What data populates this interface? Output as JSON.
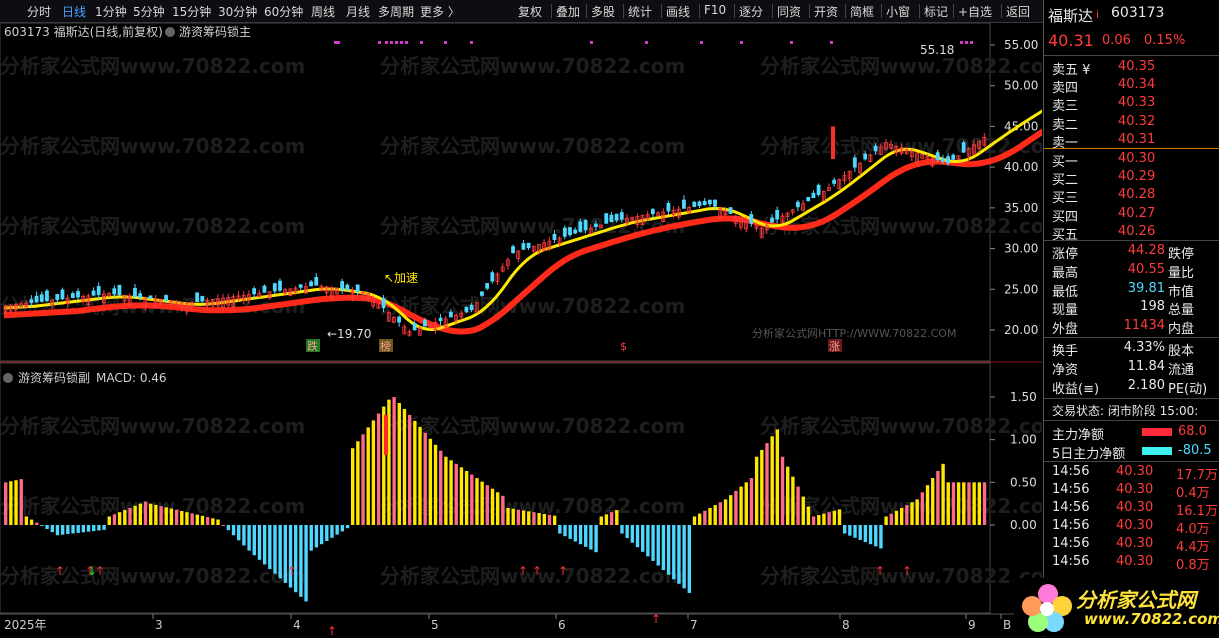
{
  "toolbar": {
    "left": [
      "分时",
      "日线",
      "1分钟",
      "5分钟",
      "15分钟",
      "30分钟",
      "60分钟",
      "周线",
      "月线",
      "多周期",
      "更多 〉"
    ],
    "active": "日线",
    "right": [
      "复权",
      "叠加",
      "多股",
      "统计",
      "画线",
      "F10",
      "逐分",
      "同资",
      "开资",
      "简框",
      "小窗",
      "标记",
      "+自选",
      "返回"
    ]
  },
  "main_chart": {
    "title": "603173 福斯达(日线,前复权)",
    "indicator_name": "游资筹码锁主",
    "y_ticks": [
      "55.00",
      "50.00",
      "45.00",
      "40.00",
      "35.00",
      "30.00",
      "25.00",
      "20.00"
    ],
    "high_label": "55.18",
    "low_label": "19.70",
    "accel_label": "加速",
    "watermark": "分析家公式网www.70822.com",
    "watermark_small": "分析家公式网HTTP://WWW.70822.COM",
    "markers": [
      "跌",
      "榜",
      "$",
      "涨"
    ]
  },
  "sub_chart": {
    "indicator_name": "游资筹码锁副",
    "macd_label": "MACD: 0.46",
    "y_ticks": [
      "1.50",
      "1.00",
      "0.50",
      "0.00"
    ]
  },
  "x_axis": [
    "2025年",
    "3",
    "4",
    "5",
    "6",
    "7",
    "8",
    "9",
    "B"
  ],
  "quote": {
    "name": "福斯达",
    "code": "603173",
    "price": "40.31",
    "change": "0.06",
    "change_pct": "0.15%",
    "sells": [
      {
        "label": "卖五 ¥",
        "price": "40.35"
      },
      {
        "label": "卖四",
        "price": "40.34"
      },
      {
        "label": "卖三",
        "price": "40.33"
      },
      {
        "label": "卖二",
        "price": "40.32"
      },
      {
        "label": "卖一",
        "price": "40.31"
      }
    ],
    "buys": [
      {
        "label": "买一",
        "price": "40.30"
      },
      {
        "label": "买二",
        "price": "40.29"
      },
      {
        "label": "买三",
        "price": "40.28"
      },
      {
        "label": "买四",
        "price": "40.27"
      },
      {
        "label": "买五",
        "price": "40.26"
      }
    ],
    "stats": [
      {
        "label": "涨停",
        "value": "44.28",
        "label2": "跌停",
        "color": "red"
      },
      {
        "label": "最高",
        "value": "40.55",
        "label2": "量比",
        "color": "red"
      },
      {
        "label": "最低",
        "value": "39.81",
        "label2": "市值",
        "color": "cyan"
      },
      {
        "label": "现量",
        "value": "198",
        "label2": "总量",
        "color": "white"
      },
      {
        "label": "外盘",
        "value": "11434",
        "label2": "内盘",
        "color": "red"
      }
    ],
    "stats2": [
      {
        "label": "换手",
        "value": "4.33%",
        "label2": "股本"
      },
      {
        "label": "净资",
        "value": "11.84",
        "label2": "流通"
      },
      {
        "label": "收益(≡)",
        "value": "2.180",
        "label2": "PE(动)"
      }
    ],
    "trade_status": "交易状态: 闭市阶段 15:00:",
    "main_net": {
      "label": "主力净额",
      "value": "68.0"
    },
    "main_net5": {
      "label": "5日主力净额",
      "value": "-80.5"
    },
    "ticks": [
      {
        "time": "14:56",
        "price": "40.30",
        "vol": "17.7万"
      },
      {
        "time": "14:56",
        "price": "40.30",
        "vol": "0.4万"
      },
      {
        "time": "14:56",
        "price": "40.30",
        "vol": "16.1万"
      },
      {
        "time": "14:56",
        "price": "40.30",
        "vol": "4.0万"
      },
      {
        "time": "14:56",
        "price": "40.30",
        "vol": "4.4万"
      },
      {
        "time": "14:56",
        "price": "40.30",
        "vol": "0.8万"
      }
    ],
    "logo_text": "分析家公式网",
    "logo_url": "www.70822.com"
  },
  "colors": {
    "up": "#ff3b3b",
    "down": "#4fd8ff",
    "yellow": "#ffe800",
    "accent": "#4da3ff"
  }
}
